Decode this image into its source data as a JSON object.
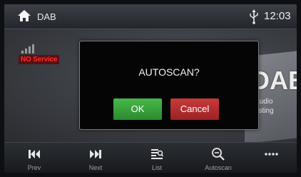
{
  "statusbar": {
    "source": "DAB",
    "time": "12:03",
    "icons": [
      "home-icon",
      "usb-icon"
    ]
  },
  "main": {
    "status_text": "NO Service",
    "logo_text": "DAB",
    "logo_sub_line1": "Audio",
    "logo_sub_line2": "asting"
  },
  "dialog": {
    "title": "AUTOSCAN?",
    "ok_label": "OK",
    "cancel_label": "Cancel"
  },
  "controls": [
    {
      "label": "Prev",
      "icon": "skip-previous-icon"
    },
    {
      "label": "Next",
      "icon": "skip-next-icon"
    },
    {
      "label": "List",
      "icon": "list-search-icon"
    },
    {
      "label": "Autoscan",
      "icon": "autoscan-search-icon"
    },
    {
      "label": "",
      "icon": "more-icon"
    }
  ],
  "colors": {
    "ok": "#3aa63d",
    "cancel": "#b52d2f",
    "no_service": "#ff2a2a"
  }
}
